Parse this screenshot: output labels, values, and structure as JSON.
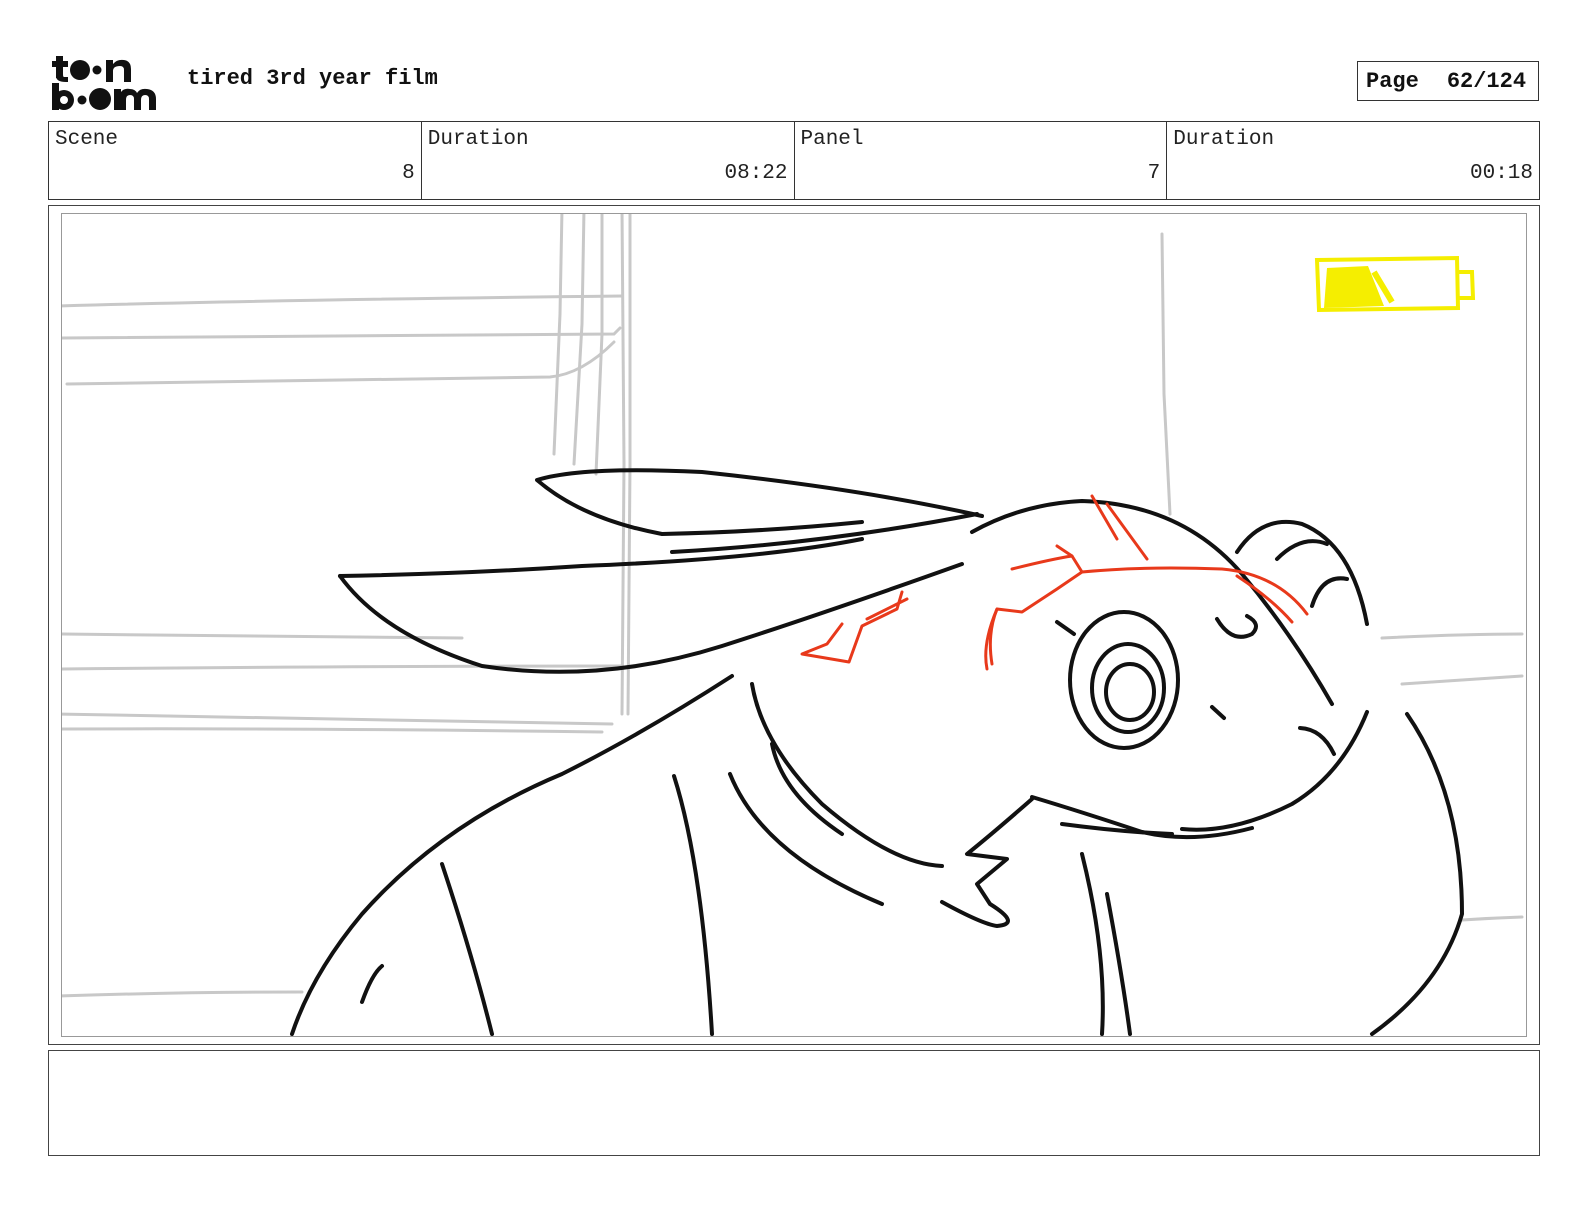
{
  "header": {
    "logo_text": "toon boom",
    "project_title": "tired 3rd year film",
    "page_label": "Page",
    "page_number": "62/124"
  },
  "info": {
    "scene_label": "Scene",
    "scene_value": "8",
    "scene_duration_label": "Duration",
    "scene_duration_value": "08:22",
    "panel_label": "Panel",
    "panel_value": "7",
    "panel_duration_label": "Duration",
    "panel_duration_value": "00:18"
  },
  "panel": {
    "battery_level": 0.45,
    "colors": {
      "background_lines": "#c8c8c8",
      "character_lines": "#111111",
      "accent_lines": "#e8391b",
      "battery": "#f5ee00"
    }
  },
  "notes": {
    "text": ""
  }
}
